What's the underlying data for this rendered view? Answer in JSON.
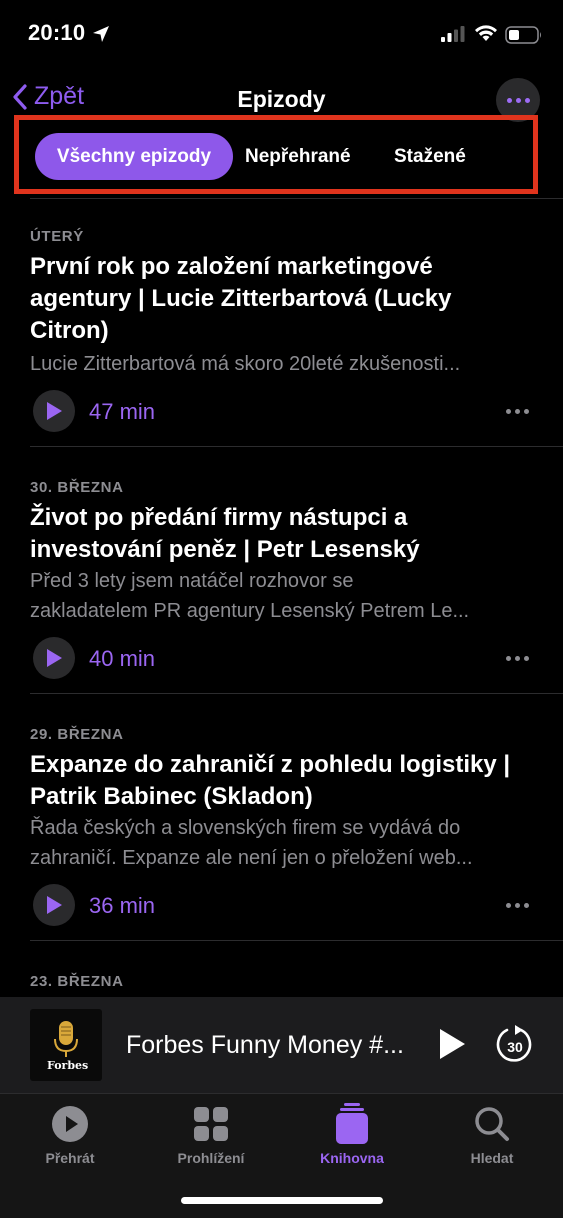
{
  "status": {
    "time": "20:10"
  },
  "nav": {
    "back_label": "Zpět",
    "title": "Epizody"
  },
  "segments": [
    "Všechny epizody",
    "Nepřehrané",
    "Stažené"
  ],
  "episodes": [
    {
      "date": "ÚTERÝ",
      "title_lines": [
        "První rok po založení marketingové",
        "agentury | Lucie Zitterbartová (Lucky",
        "Citron)"
      ],
      "desc_lines": [
        "Lucie Zitterbartová má skoro 20leté zkušenosti..."
      ],
      "duration": "47 min"
    },
    {
      "date": "30. BŘEZNA",
      "title_lines": [
        "Život po předání firmy nástupci a",
        "investování peněz | Petr Lesenský"
      ],
      "desc_lines": [
        "Před 3 lety jsem natáčel rozhovor se",
        "zakladatelem PR agentury Lesenský Petrem Le..."
      ],
      "duration": "40 min"
    },
    {
      "date": "29. BŘEZNA",
      "title_lines": [
        "Expanze do zahraničí z pohledu logistiky |",
        "Patrik Babinec (Skladon)"
      ],
      "desc_lines": [
        "Řada českých a slovenských firem se vydává do",
        "zahraničí. Expanze ale není jen o přeložení web..."
      ],
      "duration": "36 min"
    },
    {
      "date": "23. BŘEZNA"
    }
  ],
  "mini_player": {
    "title": "Forbes Funny Money #...",
    "artwork_brand": "Forbes",
    "skip_seconds": "30"
  },
  "tabs": [
    {
      "label": "Přehrát",
      "icon": "play-circle-icon"
    },
    {
      "label": "Prohlížení",
      "icon": "grid-icon"
    },
    {
      "label": "Knihovna",
      "icon": "library-stack-icon"
    },
    {
      "label": "Hledat",
      "icon": "search-icon"
    }
  ],
  "colors": {
    "accent": "#9b66f2",
    "highlight_box": "#e0341d",
    "background": "#000000"
  }
}
